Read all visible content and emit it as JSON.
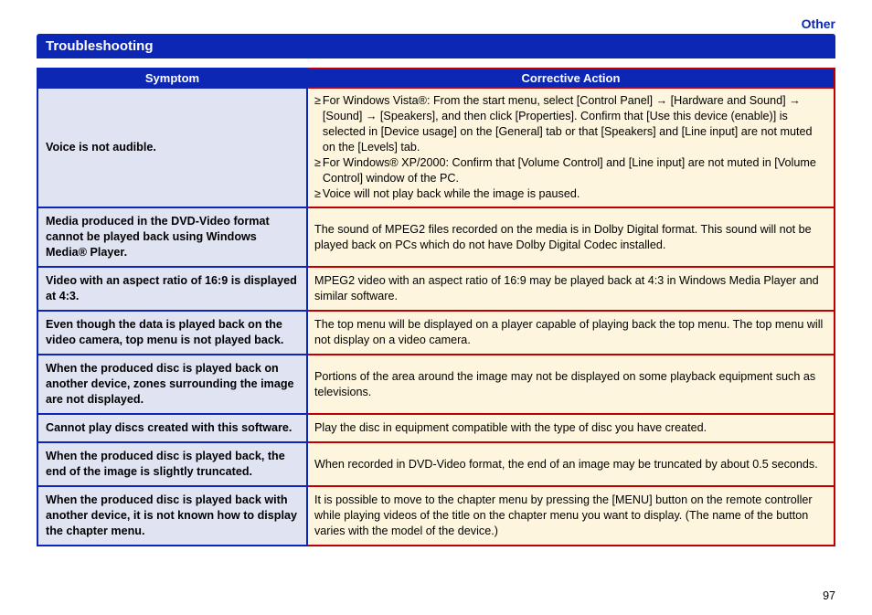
{
  "header": {
    "link": "Other"
  },
  "title": "Troubleshooting",
  "columns": {
    "symptom": "Symptom",
    "action": "Corrective Action"
  },
  "rows": [
    {
      "symptom": "Voice is not audible.",
      "action_bullets": [
        "For Windows Vista®: From the start menu, select [Control Panel] → [Hardware and Sound] → [Sound] → [Speakers], and then click [Properties]. Confirm that [Use this device (enable)] is selected in [Device usage] on the [General] tab or that [Speakers] and [Line input] are not muted on the [Levels] tab.",
        "For Windows® XP/2000: Confirm that [Volume Control] and [Line input] are not muted in [Volume Control] window of the PC.",
        "Voice will not play back while the image is paused."
      ]
    },
    {
      "symptom": "Media produced in the DVD-Video format cannot be played back using Windows Media® Player.",
      "action": "The sound of MPEG2 files recorded on the media is in Dolby Digital format. This sound will not be played back on PCs which do not have Dolby Digital Codec installed."
    },
    {
      "symptom": "Video with an aspect ratio of 16:9 is displayed at 4:3.",
      "action": "MPEG2 video with an aspect ratio of 16:9 may be played back at 4:3 in Windows Media Player and similar software."
    },
    {
      "symptom": "Even though the data is played back on the video camera, top menu is not played back.",
      "action": "The top menu will be displayed on a player capable of playing back the top menu. The top menu will not display on a video camera."
    },
    {
      "symptom": "When the produced disc is played back on another device, zones surrounding the image are not displayed.",
      "action": "Portions of the area around the image may not be displayed on some playback equipment such as televisions."
    },
    {
      "symptom": "Cannot play discs created with this software.",
      "action": "Play the disc in equipment compatible with the type of disc you have created."
    },
    {
      "symptom": "When the produced disc is played back, the end of the image is slightly truncated.",
      "action": "When recorded in DVD-Video format, the end of an image may be truncated by about 0.5 seconds."
    },
    {
      "symptom": "When the produced disc is played back with another device, it is not known how to display the chapter menu.",
      "action": "It is possible to move to the chapter menu by pressing the [MENU] button on the remote controller while playing videos of the title on the chapter menu you want to display. (The name of the button varies with the model of the device.)"
    }
  ],
  "page_number": "97"
}
